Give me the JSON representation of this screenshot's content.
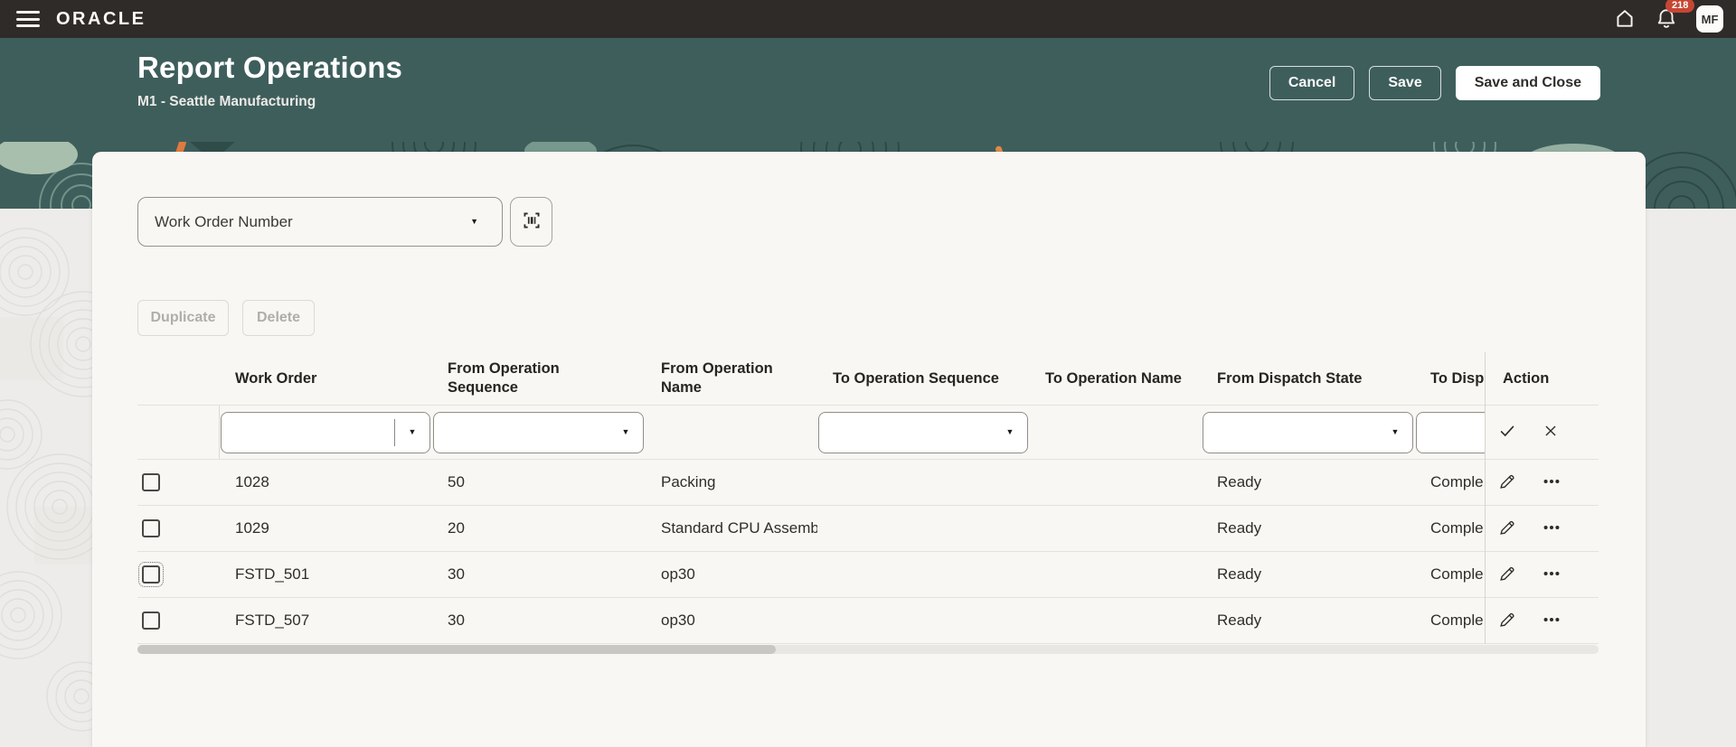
{
  "colors": {
    "topbar_bg": "#2f2b28",
    "header_teal": "#3e5e5c",
    "banner_dark_teal": "#2b4644",
    "banner_sage": "#a9bfae",
    "banner_cream": "#f0d9b0",
    "banner_orange": "#df7a3e",
    "page_bg": "#edecea",
    "card_bg": "#f9f7f4",
    "badge_bg": "#c74634"
  },
  "topbar": {
    "brand": "ORACLE",
    "notification_count": "218",
    "avatar_initials": "MF"
  },
  "header": {
    "title": "Report Operations",
    "subtitle": "M1 - Seattle Manufacturing",
    "cancel_label": "Cancel",
    "save_label": "Save",
    "save_and_close_label": "Save and Close"
  },
  "card": {
    "work_order_combobox_label": "Work Order Number",
    "duplicate_label": "Duplicate",
    "delete_label": "Delete"
  },
  "table": {
    "columns": {
      "work_order": "Work Order",
      "from_op_seq": "From Operation Sequence",
      "from_op_name": "From Operation Name",
      "to_op_seq": "To Operation Sequence",
      "to_op_name": "To Operation Name",
      "from_dispatch": "From Dispatch State",
      "to_dispatch": "To Disp",
      "action": "Action"
    },
    "rows": [
      {
        "work_order": "1028",
        "from_op_seq": "50",
        "from_op_name": "Packing",
        "to_op_seq": "",
        "to_op_name": "",
        "from_dispatch": "Ready",
        "to_dispatch": "Comple"
      },
      {
        "work_order": "1029",
        "from_op_seq": "20",
        "from_op_name": "Standard CPU Assemb",
        "to_op_seq": "",
        "to_op_name": "",
        "from_dispatch": "Ready",
        "to_dispatch": "Comple"
      },
      {
        "work_order": "FSTD_501",
        "from_op_seq": "30",
        "from_op_name": "op30",
        "to_op_seq": "",
        "to_op_name": "",
        "from_dispatch": "Ready",
        "to_dispatch": "Comple"
      },
      {
        "work_order": "FSTD_507",
        "from_op_seq": "30",
        "from_op_name": "op30",
        "to_op_seq": "",
        "to_op_name": "",
        "from_dispatch": "Ready",
        "to_dispatch": "Comple"
      }
    ]
  },
  "glyphs": {
    "caret": "▼"
  }
}
